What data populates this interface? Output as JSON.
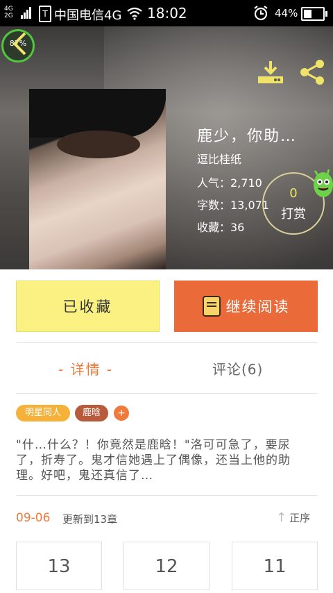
{
  "status_bar": {
    "network_top": "4G",
    "network_bottom": "2G",
    "sim_label": "T",
    "carrier": "中国电信4G",
    "time": "18:02",
    "battery": "44%",
    "battery_level": 0.44
  },
  "overlay_badge": "87%",
  "book": {
    "title": "鹿少，你助…",
    "author": "逗比桂纸",
    "popularity": "人气：2,710",
    "word_count": "字数：13,071",
    "favorites": "收藏：36"
  },
  "reward": {
    "count": "0",
    "label": "打赏"
  },
  "actions": {
    "collected_label": "已收藏",
    "continue_label": "继续阅读"
  },
  "tabs": {
    "detail": "- 详情 -",
    "comments": "评论(6)"
  },
  "tags": [
    "明星同人",
    "鹿晗"
  ],
  "tag_add": "+",
  "description": "\"什…什么？！你竟然是鹿晗！\"洛可可急了，要尿了，折寿了。鬼才信她遇上了偶像，还当上他的助理。好吧，鬼还真信了…",
  "update": {
    "date": "09-06",
    "text": "更新到13章"
  },
  "order_label": "正序",
  "chapters": [
    "13",
    "12",
    "11"
  ],
  "colors": {
    "accent": "#ef7a3b",
    "collect_button": "#faf182",
    "read_button": "#ea6a3a",
    "tag_star": "#f5b13a",
    "tag_person": "#b75b3c"
  }
}
